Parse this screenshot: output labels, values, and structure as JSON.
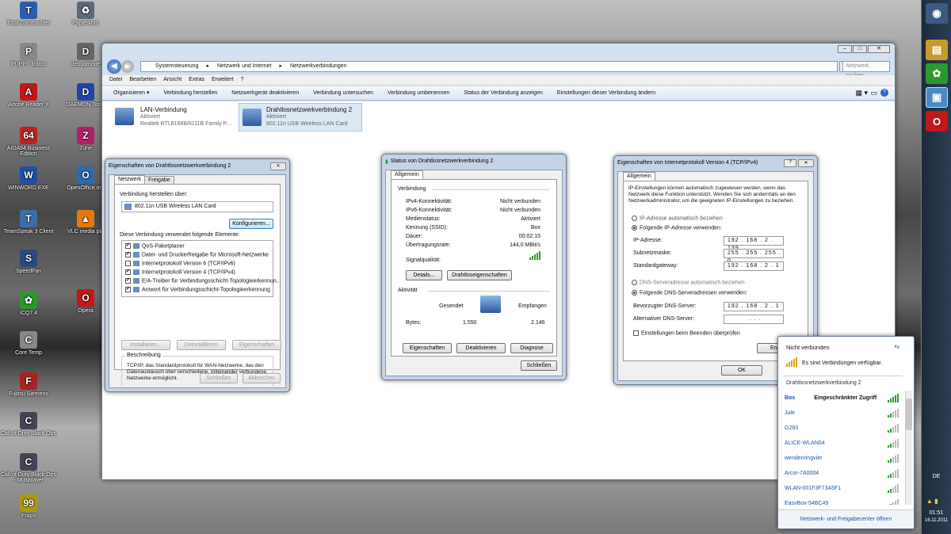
{
  "desktop": {
    "icons": [
      {
        "label": "Total Commander",
        "glyph": "T",
        "color": "#2a5db0"
      },
      {
        "label": "PUPPY Editor",
        "glyph": "P",
        "color": "#888"
      },
      {
        "label": "Adobe Reader X",
        "glyph": "A",
        "color": "#c01818"
      },
      {
        "label": "AIDA64 Business Edition",
        "glyph": "64",
        "color": "#c02020"
      },
      {
        "label": "WINWORD.EXE",
        "glyph": "W",
        "color": "#1f4fa8"
      },
      {
        "label": "TeamSpeak 3 Client",
        "glyph": "T",
        "color": "#3a6ea8"
      },
      {
        "label": "SpeedFan",
        "glyph": "S",
        "color": "#2a4a7a"
      },
      {
        "label": "ICQ7.4",
        "glyph": "✿",
        "color": "#2a9a2a"
      },
      {
        "label": "Core Temp",
        "glyph": "C",
        "color": "#888"
      },
      {
        "label": "Fujitsu Siemens",
        "glyph": "F",
        "color": "#aa2222"
      },
      {
        "label": "Call of Duty Black Ops",
        "glyph": "C",
        "color": "#445"
      },
      {
        "label": "Call of Duty Black Ops - Multiplayer",
        "glyph": "C",
        "color": "#445"
      },
      {
        "label": "Fraps",
        "glyph": "99",
        "color": "#aa9a10"
      }
    ],
    "icons2": [
      {
        "label": "Papierkorb",
        "glyph": "♻",
        "color": "#5a6a7a"
      },
      {
        "label": "debugmode",
        "glyph": "D",
        "color": "#666"
      },
      {
        "label": "DAEMON Tools",
        "glyph": "D",
        "color": "#2244aa"
      },
      {
        "label": "Zune",
        "glyph": "Z",
        "color": "#b0206a"
      },
      {
        "label": "OpenOffice.org",
        "glyph": "O",
        "color": "#2a6ab0"
      },
      {
        "label": "VLC media pla",
        "glyph": "▲",
        "color": "#e07a10"
      },
      {
        "label": "Opera",
        "glyph": "O",
        "color": "#c01818"
      }
    ]
  },
  "explorer": {
    "breadcrumb": [
      "Systemsteuerung",
      "Netzwerk und Internet",
      "Netzwerkverbindungen"
    ],
    "search_placeholder": "Netzwerk... suchen",
    "menu": [
      "Datei",
      "Bearbeiten",
      "Ansicht",
      "Extras",
      "Erweitert",
      "?"
    ],
    "toolbar": [
      "Organisieren ▾",
      "Verbindung herstellen",
      "Netzwerkgerät deaktivieren",
      "Verbindung untersuchen",
      "Verbindung umbenennen",
      "Status der Verbindung anzeigen",
      "Einstellungen dieser Verbindung ändern"
    ],
    "connections": [
      {
        "name": "LAN-Verbindung",
        "status": "Aktiviert",
        "device": "Realtek RTL8168B/8111B Family P..."
      },
      {
        "name": "Drahtlosnetzwerkverbindung 2",
        "status": "Aktiviert",
        "device": "802.11n USB Wireless LAN Card"
      }
    ]
  },
  "props": {
    "title": "Eigenschaften von Drahtlosnetzwerkverbindung 2",
    "tabs": [
      "Netzwerk",
      "Freigabe"
    ],
    "connect_via": "Verbindung herstellen über:",
    "adapter": "802.11n USB Wireless LAN Card",
    "configure": "Konfigurieren...",
    "uses_label": "Diese Verbindung verwendet folgende Elemente:",
    "items": [
      {
        "label": "QoS-Paketplaner",
        "checked": "✔"
      },
      {
        "label": "Datei- und Druckerfreigabe für Microsoft-Netzwerke",
        "checked": "✔"
      },
      {
        "label": "Internetprotokoll Version 6 (TCP/IPv6)",
        "checked": ""
      },
      {
        "label": "Internetprotokoll Version 4 (TCP/IPv4)",
        "checked": "✔"
      },
      {
        "label": "E/A-Treiber für Verbindungsschicht-Topologieerkennun...",
        "checked": "✔"
      },
      {
        "label": "Antwort für Verbindungsschicht-Topologieerkennung",
        "checked": "✔"
      }
    ],
    "install": "Installieren...",
    "uninstall": "Deinstallieren",
    "properties": "Eigenschaften",
    "desc_label": "Beschreibung",
    "desc": "TCP/IP, das Standardprotokoll für WAN-Netzwerke, das den Datenaustausch über verschiedene, miteinander verbundene Netzwerke ermöglicht.",
    "close": "Schließen",
    "cancel": "Abbrechen"
  },
  "status": {
    "title": "Status von Drahtlosnetzwerkverbindung 2",
    "tab": "Allgemein",
    "section_conn": "Verbindung",
    "rows": [
      {
        "k": "IPv4-Konnektivität:",
        "v": "Nicht verbunden"
      },
      {
        "k": "IPv6-Konnektivität:",
        "v": "Nicht verbunden"
      },
      {
        "k": "Medienstatus:",
        "v": "Aktiviert"
      },
      {
        "k": "Kennung (SSID):",
        "v": "Box"
      },
      {
        "k": "Dauer:",
        "v": "00:02:15"
      },
      {
        "k": "Übertragungsrate:",
        "v": "144,0 MBit/s"
      }
    ],
    "signal_label": "Signalqualität:",
    "details": "Details...",
    "wireless_props": "Drahtloseigenschaften",
    "section_activity": "Aktivität",
    "sent": "Gesendet",
    "received": "Empfangen",
    "bytes_label": "Bytes:",
    "bytes_sent": "1.550",
    "bytes_received": "2.146",
    "btn_props": "Eigenschaften",
    "btn_disable": "Deaktivieren",
    "btn_diagnose": "Diagnose",
    "close": "Schließen"
  },
  "ipv4": {
    "title": "Eigenschaften von Internetprotokoll Version 4 (TCP/IPv4)",
    "tab": "Allgemein",
    "intro": "IP-Einstellungen können automatisch zugewiesen werden, wenn das Netzwerk diese Funktion unterstützt. Wenden Sie sich andernfalls an den Netzwerkadministrator, um die geeigneten IP-Einstellungen zu beziehen.",
    "auto_ip": "IP-Adresse automatisch beziehen",
    "manual_ip": "Folgende IP-Adresse verwenden:",
    "ip_label": "IP-Adresse:",
    "ip": "192 . 168 . 2 . 139",
    "mask_label": "Subnetzmaske:",
    "mask": "255 . 255 . 255 . 0",
    "gw_label": "Standardgateway:",
    "gw": "192 . 168 . 2 . 1",
    "auto_dns": "DNS-Serveradresse automatisch beziehen",
    "manual_dns": "Folgende DNS-Serveradressen verwenden:",
    "dns1_label": "Bevorzugter DNS-Server:",
    "dns1": "192 . 168 . 2 . 1",
    "dns2_label": "Alternativer DNS-Server:",
    "dns2": ". . .",
    "validate": "Einstellungen beim Beenden überprüfen",
    "advanced": "Erwe",
    "ok": "OK"
  },
  "wifi": {
    "header": "Nicht verbunden",
    "available": "Es sind Verbindungen verfügbar.",
    "group": "Drahtlosnetzwerkverbindung 2",
    "networks": [
      {
        "name": "Box",
        "status": "Eingeschränkter Zugriff"
      },
      {
        "name": "Jule",
        "status": ""
      },
      {
        "name": "G283",
        "status": ""
      },
      {
        "name": "ALICE-WLAN04",
        "status": ""
      },
      {
        "name": "wendenringvier",
        "status": ""
      },
      {
        "name": "Arcor-7A0004",
        "status": ""
      },
      {
        "name": "WLAN-001F3F73A5F1",
        "status": ""
      },
      {
        "name": "EasyBox-54BC49",
        "status": ""
      }
    ],
    "footer": "Netzwerk- und Freigabecenter öffnen"
  },
  "tray": {
    "lang": "DE",
    "time": "01:51",
    "date": "16.11.2011"
  }
}
